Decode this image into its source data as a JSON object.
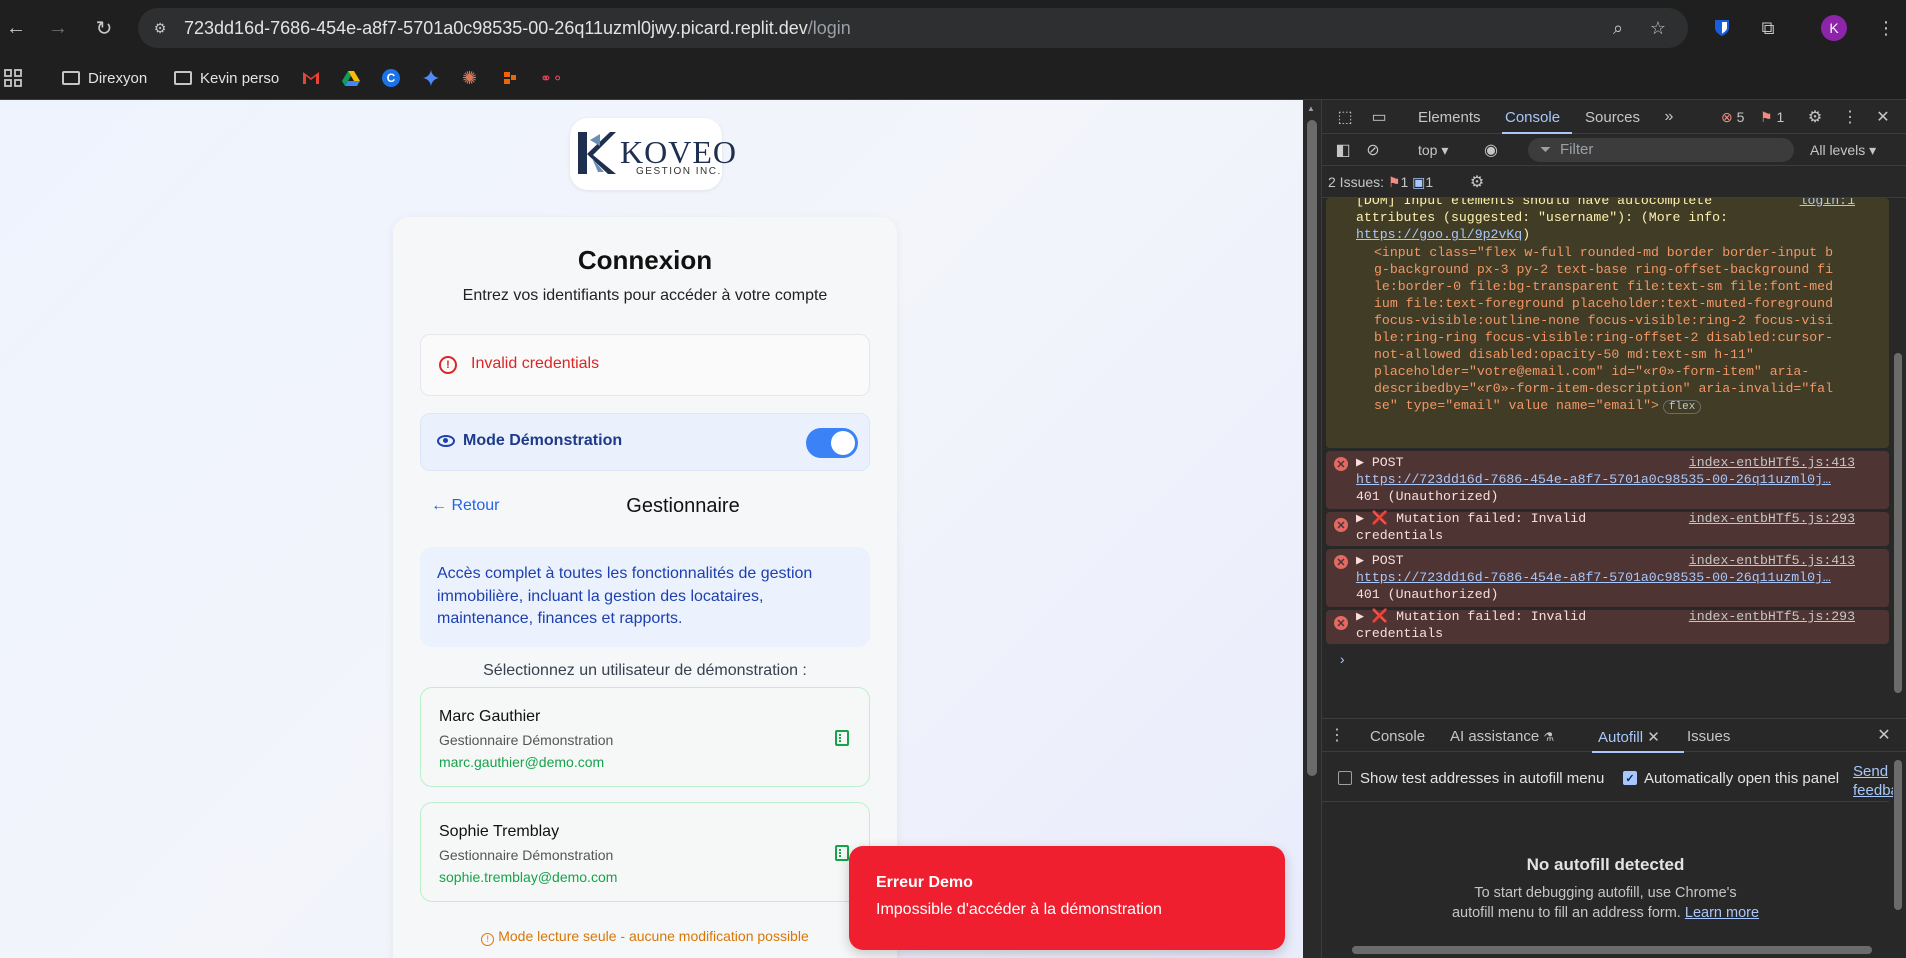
{
  "browser": {
    "url_host": "723dd16d-7686-454e-a8f7-5701a0c98535-00-26q11uzml0jwy.picard.replit.dev",
    "url_path": "/login",
    "avatar_letter": "K",
    "bookmarks": [
      "Direxyon",
      "Kevin perso"
    ]
  },
  "page": {
    "logo_name": "KOVEO",
    "logo_sub": "GESTION INC.",
    "title": "Connexion",
    "subtitle": "Entrez vos identifiants pour accéder à votre compte",
    "error": "Invalid credentials",
    "demo_mode_label": "Mode Démonstration",
    "demo_mode_on": true,
    "back_link": "← Retour",
    "role_title": "Gestionnaire",
    "role_description": "Accès complet à toutes les fonctionnalités de gestion immobilière, incluant la gestion des locataires, maintenance, finances et rapports.",
    "select_label": "Sélectionnez un utilisateur de démonstration :",
    "users": [
      {
        "name": "Marc Gauthier",
        "role": "Gestionnaire Démonstration",
        "email": "marc.gauthier@demo.com"
      },
      {
        "name": "Sophie Tremblay",
        "role": "Gestionnaire Démonstration",
        "email": "sophie.tremblay@demo.com"
      }
    ],
    "readonly_note": "Mode lecture seule - aucune modification possible",
    "toast": {
      "title": "Erreur Demo",
      "message": "Impossible d'accéder à la démonstration"
    }
  },
  "devtools": {
    "tabs": [
      "Elements",
      "Console",
      "Sources"
    ],
    "error_count": "5",
    "issue_count": "1",
    "context": "top",
    "filter_placeholder": "Filter",
    "levels": "All levels",
    "issues_label": "2 Issues:",
    "issues_err": "1",
    "issues_info": "1",
    "console": {
      "warn_lines": [
        "[DOM] Input elements should have autocomplete",
        "attributes (suggested: \"username\"): (More info:"
      ],
      "warn_source": "login:1",
      "warn_link": "https://goo.gl/9p2vKq",
      "html_lines": [
        "<input class=\"flex w-full rounded-md border border-input b",
        "g-background px-3 py-2 text-base ring-offset-background fi",
        "le:border-0 file:bg-transparent file:text-sm file:font-med",
        "ium file:text-foreground placeholder:text-muted-foreground",
        "focus-visible:outline-none focus-visible:ring-2 focus-visi",
        "ble:ring-ring focus-visible:ring-offset-2 disabled:cursor-",
        "not-allowed disabled:opacity-50 md:text-sm h-11\"",
        "placeholder=\"votre@email.com\" id=\"«r0»-form-item\" aria-",
        "describedby=\"«r0»-form-item-description\" aria-invalid=\"fal",
        "se\" type=\"email\" value name=\"email\">"
      ],
      "flex_badge": "flex",
      "post_label": "▶ POST",
      "post_source": "index-entbHTf5.js:413",
      "post_url": "https://723dd16d-7686-454e-a8f7-5701a0c98535-00-26q11uzml0j…",
      "post_status": "401 (Unauthorized)",
      "mutation_label": "▶ ❌ Mutation failed: Invalid",
      "mutation_label2": "credentials",
      "mutation_source": "index-entbHTf5.js:293"
    },
    "drawer": {
      "tabs": [
        "Console",
        "AI assistance",
        "Autofill",
        "Issues"
      ],
      "show_test": "Show test addresses in autofill menu",
      "auto_open": "Automatically open this panel",
      "send_feedback": "Send feedback",
      "empty_title": "No autofill detected",
      "empty_desc_1": "To start debugging autofill, use Chrome's",
      "empty_desc_2": "autofill menu to fill an address form.",
      "learn_more": "Learn more"
    }
  },
  "colors": {
    "accent": "#3b82f6",
    "error": "#dc2626",
    "toast": "#ef1f2f",
    "success": "#16a34a",
    "warning": "#d97706"
  }
}
